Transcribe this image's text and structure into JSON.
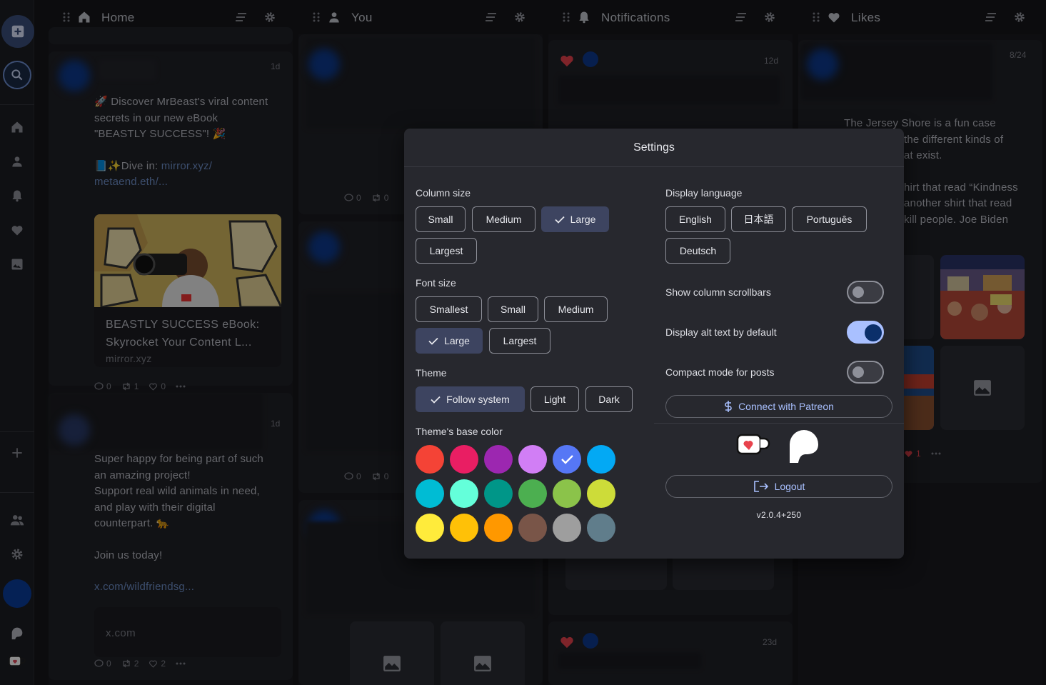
{
  "columns": [
    {
      "title": "Home",
      "icon": "home-icon"
    },
    {
      "title": "You",
      "icon": "person-icon"
    },
    {
      "title": "Notifications",
      "icon": "bell-icon"
    },
    {
      "title": "Likes",
      "icon": "heart-icon"
    }
  ],
  "home": {
    "post1": {
      "time": "1d",
      "line1": "🚀 Discover MrBeast's viral content",
      "line2": "secrets in our new eBook",
      "line3": "\"BEASTLY SUCCESS\"! 🎉",
      "line4": "📘✨Dive in: ",
      "link1": "mirror.xyz/",
      "link2": "metaend.eth/...",
      "card_title1": "BEASTLY SUCCESS eBook:",
      "card_title2": "Skyrocket Your Content L...",
      "card_domain": "mirror.xyz",
      "replies": "0",
      "boosts": "1",
      "likes": "0"
    },
    "post2": {
      "time": "1d",
      "l1": "Super happy for being part of such",
      "l2": "an amazing project!",
      "l3": "Support real wild animals in need,",
      "l4": "and play with their digital",
      "l5": "counterpart. 🐆",
      "l6": "Join us today!",
      "link": "x.com/wildfriendsg...",
      "card_domain": "x.com",
      "replies": "0",
      "boosts": "2",
      "likes": "2"
    }
  },
  "you": {
    "a_replies": "0",
    "a_boosts": "0",
    "b_replies": "0",
    "b_boosts": "0"
  },
  "notifications": {
    "time1": "12d",
    "time2": "23d"
  },
  "likes": {
    "time": "8/24",
    "l1": "The Jersey Shore is a fun case",
    "l2": "the different kinds of",
    "l3": "at exist.",
    "l4": "hirt that read “Kindness",
    "l5": "another shirt that read",
    "l6": "kill people. Joe Biden",
    "like_count": "1"
  },
  "settings": {
    "title": "Settings",
    "column_size": {
      "label": "Column size",
      "options": [
        "Small",
        "Medium",
        "Large",
        "Largest"
      ],
      "selected": "Large"
    },
    "font_size": {
      "label": "Font size",
      "options": [
        "Smallest",
        "Small",
        "Medium",
        "Large",
        "Largest"
      ],
      "selected": "Large"
    },
    "theme": {
      "label": "Theme",
      "options": [
        "Follow system",
        "Light",
        "Dark"
      ],
      "selected": "Follow system"
    },
    "base_color": {
      "label": "Theme's base color",
      "colors": [
        "#f44336",
        "#e91e63",
        "#9c27b0",
        "#d17ef5",
        "#5677f5",
        "#03a9f4",
        "#00bcd4",
        "#64ffda",
        "#009688",
        "#4caf50",
        "#8bc34a",
        "#cddc39",
        "#ffeb3b",
        "#ffc107",
        "#ff9800",
        "#795548",
        "#9e9e9e",
        "#607d8b"
      ],
      "selected_index": 4
    },
    "display_language": {
      "label": "Display language",
      "options": [
        "English",
        "日本語",
        "Português",
        "Deutsch"
      ]
    },
    "toggles": [
      {
        "label": "Show column scrollbars",
        "on": false
      },
      {
        "label": "Display alt text by default",
        "on": true
      },
      {
        "label": "Compact mode for posts",
        "on": false
      }
    ],
    "patreon_label": "Connect with Patreon",
    "logout_label": "Logout",
    "version": "v2.0.4+250"
  }
}
